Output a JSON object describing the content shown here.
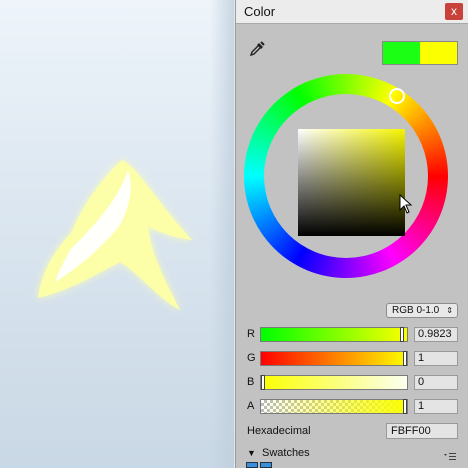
{
  "window": {
    "title": "Color",
    "close_label": "x"
  },
  "icons": {
    "eyedropper": "eyedropper-icon",
    "close": "close-icon",
    "dropdown": "chevron-updown-icon",
    "swatches_menu": "menu-icon",
    "pointer": "arrow-cursor-icon"
  },
  "colors": {
    "previous": "#1bff14",
    "current": "#fbff00"
  },
  "mode": {
    "selected": "RGB 0-1.0",
    "arrow": "⇕"
  },
  "channels": [
    {
      "label": "R",
      "value": "0.9823",
      "level": 0.9823
    },
    {
      "label": "G",
      "value": "1",
      "level": 1
    },
    {
      "label": "B",
      "value": "0",
      "level": 0
    },
    {
      "label": "A",
      "value": "1",
      "level": 1
    }
  ],
  "hex": {
    "label": "Hexadecimal",
    "value": "FBFF00"
  },
  "swatches": {
    "label": "Swatches",
    "toggle": "▼"
  }
}
